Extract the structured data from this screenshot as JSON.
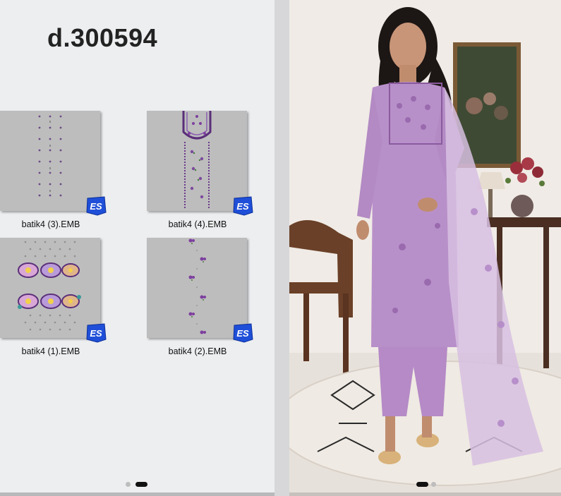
{
  "left_panel": {
    "design_code": "d.300594",
    "files": [
      {
        "label": "batik4 (3).EMB",
        "badge": "ES"
      },
      {
        "label": "batik4 (4).EMB",
        "badge": "ES"
      },
      {
        "label": "batik4 (1).EMB",
        "badge": "ES"
      },
      {
        "label": "batik4 (2).EMB",
        "badge": "ES"
      }
    ]
  },
  "colors": {
    "badge_blue": "#1f4fd8",
    "embroidery_purple": "#6b3a8c",
    "outfit_lilac": "#b890c9"
  }
}
